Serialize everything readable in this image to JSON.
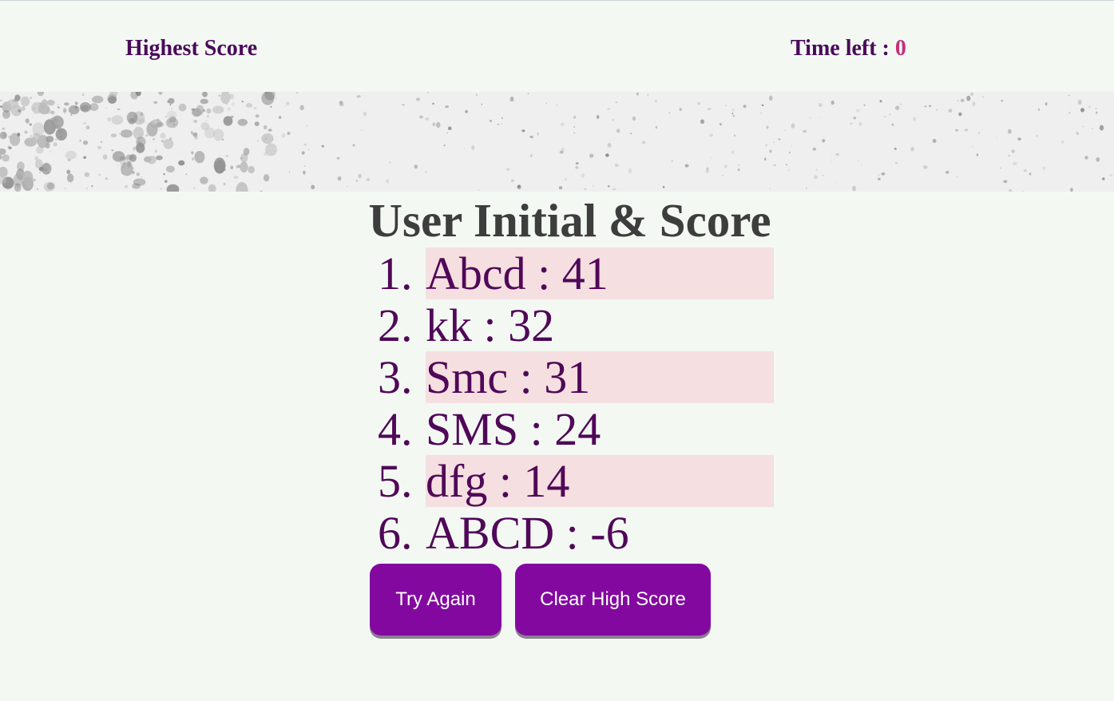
{
  "header": {
    "highest_score_label": "Highest Score",
    "time_left_label": "Time left : ",
    "time_left_value": "0"
  },
  "main": {
    "title": "User Initial & Score",
    "scores": [
      {
        "rank": "1.",
        "entry": "Abcd : 41"
      },
      {
        "rank": "2.",
        "entry": "kk : 32"
      },
      {
        "rank": "3.",
        "entry": "Smc : 31"
      },
      {
        "rank": "4.",
        "entry": "SMS : 24"
      },
      {
        "rank": "5.",
        "entry": "dfg : 14"
      },
      {
        "rank": "6.",
        "entry": "ABCD : -6"
      }
    ]
  },
  "buttons": {
    "try_again": "Try Again",
    "clear_high_score": "Clear High Score"
  },
  "colors": {
    "background": "#f3f8f3",
    "text_purple": "#500858",
    "timer_value": "#c2307a",
    "button": "#8308a0",
    "row_highlight": "#f5dfe0"
  }
}
